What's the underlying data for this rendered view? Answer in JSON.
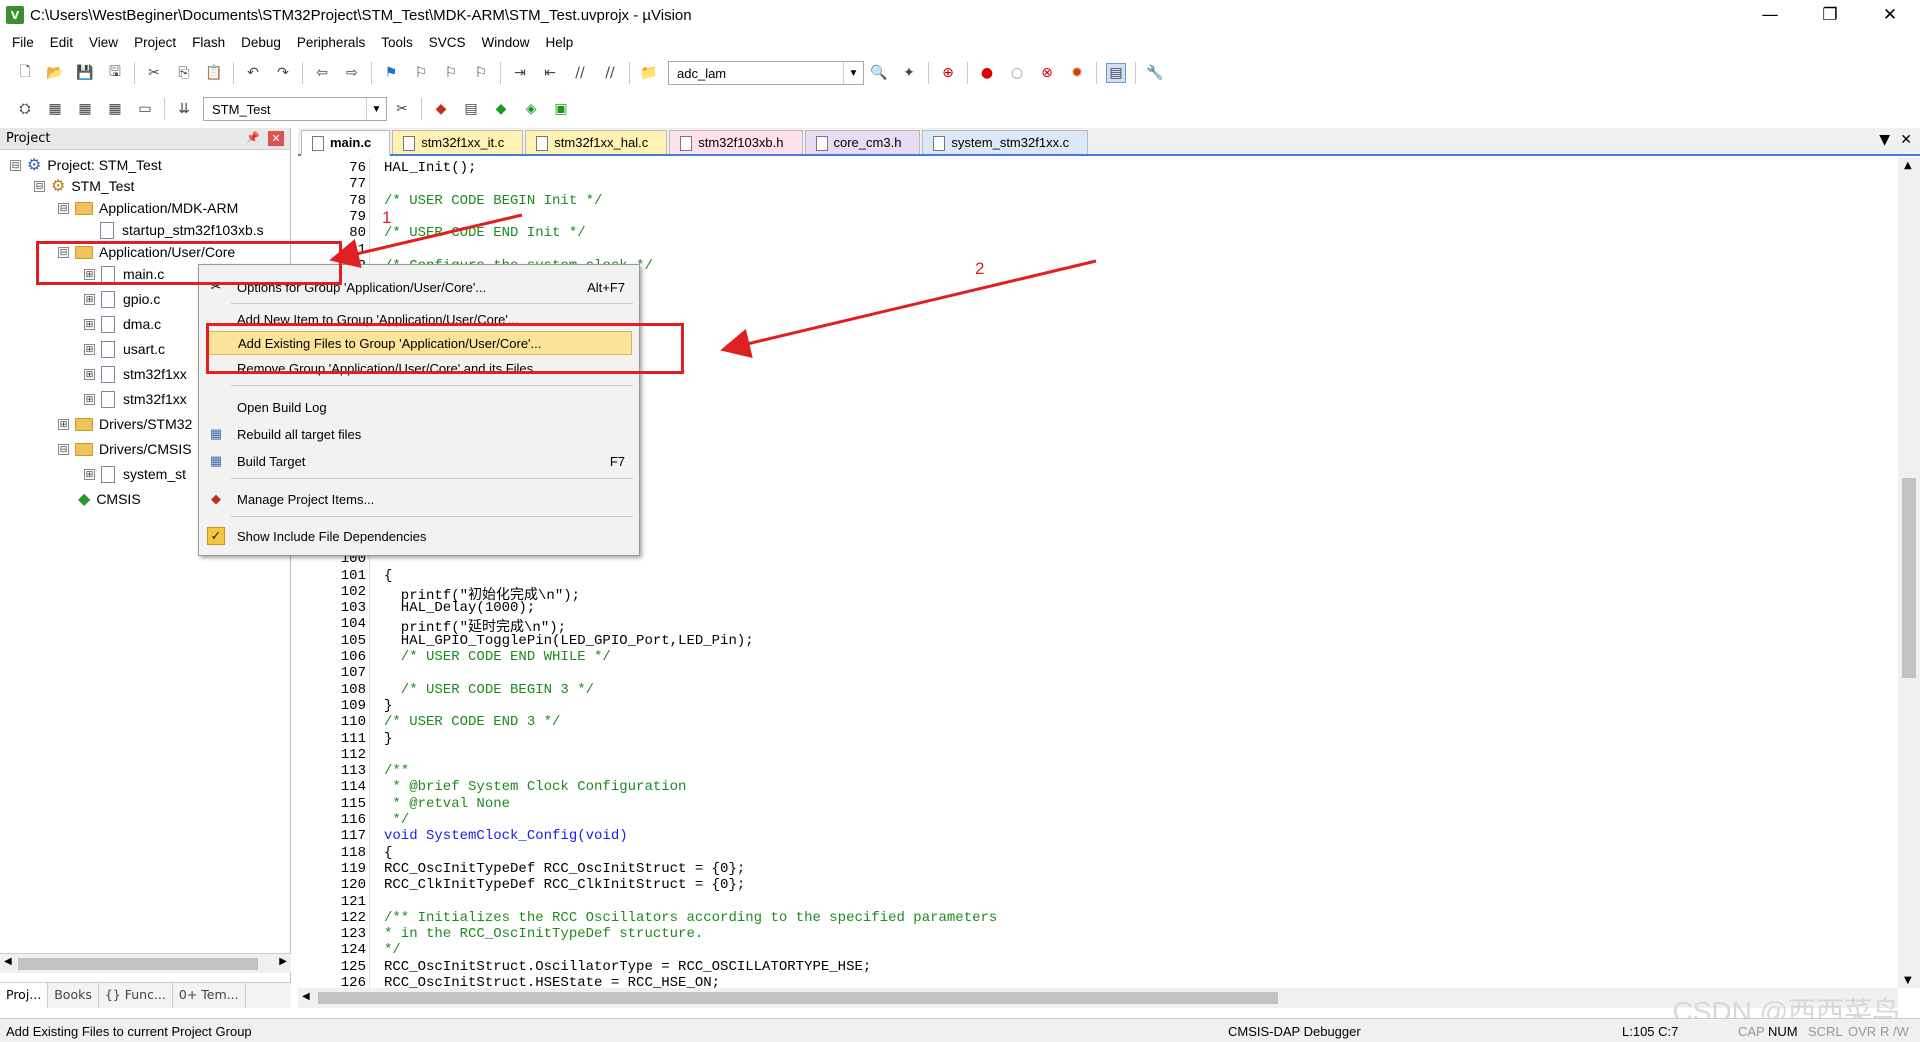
{
  "window": {
    "title": "C:\\Users\\WestBeginer\\Documents\\STM32Project\\STM_Test\\MDK-ARM\\STM_Test.uvprojx - µVision",
    "minimize": "—",
    "restore": "❐",
    "close": "✕"
  },
  "menu": [
    "File",
    "Edit",
    "View",
    "Project",
    "Flash",
    "Debug",
    "Peripherals",
    "Tools",
    "SVCS",
    "Window",
    "Help"
  ],
  "toolbar": {
    "find_combo": "adc_lam",
    "target_combo": "STM_Test"
  },
  "project_panel": {
    "title": "Project",
    "pin": "📌",
    "close": "✕",
    "tree": [
      {
        "label": "Project: STM_Test",
        "exp": "⊟"
      },
      {
        "label": "STM_Test",
        "exp": "⊟"
      },
      {
        "label": "Application/MDK-ARM",
        "exp": "⊟"
      },
      {
        "label": "startup_stm32f103xb.s",
        "exp": ""
      },
      {
        "label": "Application/User/Core",
        "exp": "⊟"
      },
      {
        "label": "main.c",
        "exp": "⊞"
      },
      {
        "label": "gpio.c",
        "exp": "⊞"
      },
      {
        "label": "dma.c",
        "exp": "⊞"
      },
      {
        "label": "usart.c",
        "exp": "⊞"
      },
      {
        "label": "stm32f1xx",
        "exp": "⊞"
      },
      {
        "label": "stm32f1xx",
        "exp": "⊞"
      },
      {
        "label": "Drivers/STM32",
        "exp": "⊞"
      },
      {
        "label": "Drivers/CMSIS",
        "exp": "⊟"
      },
      {
        "label": "system_st",
        "exp": "⊞"
      },
      {
        "label": "CMSIS",
        "exp": ""
      }
    ],
    "bottom_tabs": [
      "Proj...",
      "Books",
      "{} Func...",
      "0+ Tem..."
    ]
  },
  "editor_tabs": [
    "main.c",
    "stm32f1xx_it.c",
    "stm32f1xx_hal.c",
    "stm32f103xb.h",
    "core_cm3.h",
    "system_stm32f1xx.c"
  ],
  "tab_colors": [
    "#ffffff",
    "#fff2b3",
    "#fff2b3",
    "#fde0ea",
    "#e8dcf5",
    "#dbe9f7"
  ],
  "code_lines": [
    {
      "n": "76",
      "t": "HAL_Init();",
      "c": ""
    },
    {
      "n": "77",
      "t": "",
      "c": ""
    },
    {
      "n": "78",
      "t": "/* USER CODE BEGIN Init */",
      "c": "cm"
    },
    {
      "n": "79",
      "t": "",
      "c": ""
    },
    {
      "n": "80",
      "t": "/* USER CODE END Init */",
      "c": "cm"
    },
    {
      "n": "81",
      "t": "",
      "c": ""
    },
    {
      "n": "82",
      "t": "/* Configure the system clock */",
      "c": "cm"
    },
    {
      "n": "83",
      "t": "",
      "c": ""
    },
    {
      "n": "84",
      "t": "",
      "c": ""
    },
    {
      "n": "85",
      "t": "",
      "c": ""
    },
    {
      "n": "86",
      "t": "",
      "c": ""
    },
    {
      "n": "87",
      "t": "",
      "c": ""
    },
    {
      "n": "88",
      "t": "",
      "c": ""
    },
    {
      "n": "89",
      "t": "",
      "c": ""
    },
    {
      "n": "90",
      "t": "",
      "c": ""
    },
    {
      "n": "91",
      "t": "",
      "c": ""
    },
    {
      "n": "92",
      "t": "",
      "c": ""
    },
    {
      "n": "93",
      "t": "",
      "c": ""
    },
    {
      "n": "94",
      "t": "",
      "c": ""
    },
    {
      "n": "95",
      "t": "",
      "c": ""
    },
    {
      "n": "96",
      "t": "",
      "c": ""
    },
    {
      "n": "97",
      "t": "",
      "c": ""
    },
    {
      "n": "98",
      "t": "",
      "c": ""
    },
    {
      "n": "99",
      "t": "",
      "c": ""
    },
    {
      "n": "100",
      "t": "",
      "c": ""
    },
    {
      "n": "101",
      "t": "{",
      "c": ""
    },
    {
      "n": "102",
      "t": "  printf(\"初始化完成\\n\");",
      "c": ""
    },
    {
      "n": "103",
      "t": "  HAL_Delay(1000);",
      "c": ""
    },
    {
      "n": "104",
      "t": "  printf(\"延时完成\\n\");",
      "c": ""
    },
    {
      "n": "105",
      "t": "  HAL_GPIO_TogglePin(LED_GPIO_Port,LED_Pin);",
      "c": ""
    },
    {
      "n": "106",
      "t": "  /* USER CODE END WHILE */",
      "c": "cm"
    },
    {
      "n": "107",
      "t": "",
      "c": ""
    },
    {
      "n": "108",
      "t": "  /* USER CODE BEGIN 3 */",
      "c": "cm"
    },
    {
      "n": "109",
      "t": "}",
      "c": ""
    },
    {
      "n": "110",
      "t": "/* USER CODE END 3 */",
      "c": "cm"
    },
    {
      "n": "111",
      "t": "}",
      "c": ""
    },
    {
      "n": "112",
      "t": "",
      "c": ""
    },
    {
      "n": "113",
      "t": "/**",
      "c": "cm"
    },
    {
      "n": "114",
      "t": " * @brief System Clock Configuration",
      "c": "cm"
    },
    {
      "n": "115",
      "t": " * @retval None",
      "c": "cm"
    },
    {
      "n": "116",
      "t": " */",
      "c": "cm"
    },
    {
      "n": "117",
      "t": "void SystemClock_Config(void)",
      "c": "kw"
    },
    {
      "n": "118",
      "t": "{",
      "c": ""
    },
    {
      "n": "119",
      "t": "RCC_OscInitTypeDef RCC_OscInitStruct = {0};",
      "c": ""
    },
    {
      "n": "120",
      "t": "RCC_ClkInitTypeDef RCC_ClkInitStruct = {0};",
      "c": ""
    },
    {
      "n": "121",
      "t": "",
      "c": ""
    },
    {
      "n": "122",
      "t": "/** Initializes the RCC Oscillators according to the specified parameters",
      "c": "cm"
    },
    {
      "n": "123",
      "t": "* in the RCC_OscInitTypeDef structure.",
      "c": "cm"
    },
    {
      "n": "124",
      "t": "*/",
      "c": "cm"
    },
    {
      "n": "125",
      "t": "RCC_OscInitStruct.OscillatorType = RCC_OSCILLATORTYPE_HSE;",
      "c": ""
    },
    {
      "n": "126",
      "t": "RCC_OscInitStruct.HSEState = RCC_HSE_ON;",
      "c": ""
    }
  ],
  "context_menu": {
    "items": [
      {
        "label": "Options for Group 'Application/User/Core'...",
        "shortcut": "Alt+F7",
        "icon": "✂"
      },
      {
        "label": "Add New  Item to Group 'Application/User/Core'...",
        "shortcut": "",
        "icon": ""
      },
      {
        "label": "Add Existing Files to Group 'Application/User/Core'...",
        "shortcut": "",
        "icon": ""
      },
      {
        "label": "Remove Group 'Application/User/Core' and its Files",
        "shortcut": "",
        "icon": ""
      },
      {
        "label": "Open Build Log",
        "shortcut": "",
        "icon": ""
      },
      {
        "label": "Rebuild all target files",
        "shortcut": "",
        "icon": "▦"
      },
      {
        "label": "Build Target",
        "shortcut": "F7",
        "icon": "▦"
      },
      {
        "label": "Manage Project Items...",
        "shortcut": "",
        "icon": "◆"
      },
      {
        "label": "Show Include File Dependencies",
        "shortcut": "",
        "icon": "✓"
      }
    ]
  },
  "annotations": {
    "label1": "1",
    "label2": "2",
    "color": "#e02020"
  },
  "status": {
    "message": "Add Existing Files to current Project Group",
    "debugger": "CMSIS-DAP Debugger",
    "position": "L:105 C:7",
    "caps": "CAP",
    "num": "NUM",
    "scrl": "SCRL",
    "ovr": "OVR",
    "rw": "R /W"
  },
  "watermark": "CSDN @西西菜鸟"
}
